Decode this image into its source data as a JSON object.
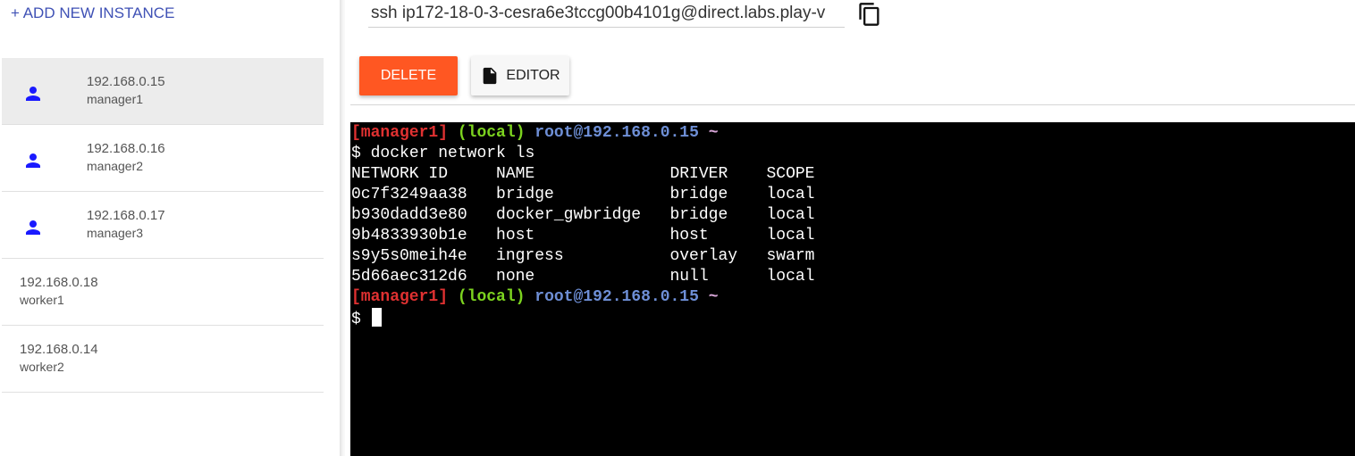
{
  "sidebar": {
    "add_instance_label": "+ ADD NEW INSTANCE",
    "instances": [
      {
        "ip": "192.168.0.15",
        "hostname": "manager1",
        "role": "manager",
        "active": true,
        "icon": "user-icon"
      },
      {
        "ip": "192.168.0.16",
        "hostname": "manager2",
        "role": "manager",
        "active": false,
        "icon": "user-icon"
      },
      {
        "ip": "192.168.0.17",
        "hostname": "manager3",
        "role": "manager",
        "active": false,
        "icon": "user-icon"
      },
      {
        "ip": "192.168.0.18",
        "hostname": "worker1",
        "role": "worker",
        "active": false
      },
      {
        "ip": "192.168.0.14",
        "hostname": "worker2",
        "role": "worker",
        "active": false
      }
    ]
  },
  "top_panel": {
    "ssh_command": "ssh ip172-18-0-3-cesra6e3tccg00b4101g@direct.labs.play-v",
    "copy_icon": "copy-icon",
    "delete_label": "DELETE",
    "editor_label": "EDITOR",
    "editor_icon": "file-icon"
  },
  "terminal": {
    "prompt": {
      "host": "[manager1]",
      "env": "(local)",
      "user": "root@192.168.0.15",
      "dir": "~",
      "symbol": "$"
    },
    "command": "docker network ls",
    "output": [
      "NETWORK ID     NAME              DRIVER    SCOPE",
      "0c7f3249aa38   bridge            bridge    local",
      "b930dadd3e80   docker_gwbridge   bridge    local",
      "9b4833930b1e   host              host      local",
      "s9y5s0meih4e   ingress           overlay   swarm",
      "5d66aec312d6   none              null      local"
    ]
  },
  "colors": {
    "accent": "#3f51b5",
    "delete": "#ff5722",
    "user_icon": "#1a1aff",
    "terminal_bg": "#000000",
    "prompt_host": "#e03131",
    "prompt_env": "#7cd31f",
    "prompt_user": "#6e8fd6"
  }
}
